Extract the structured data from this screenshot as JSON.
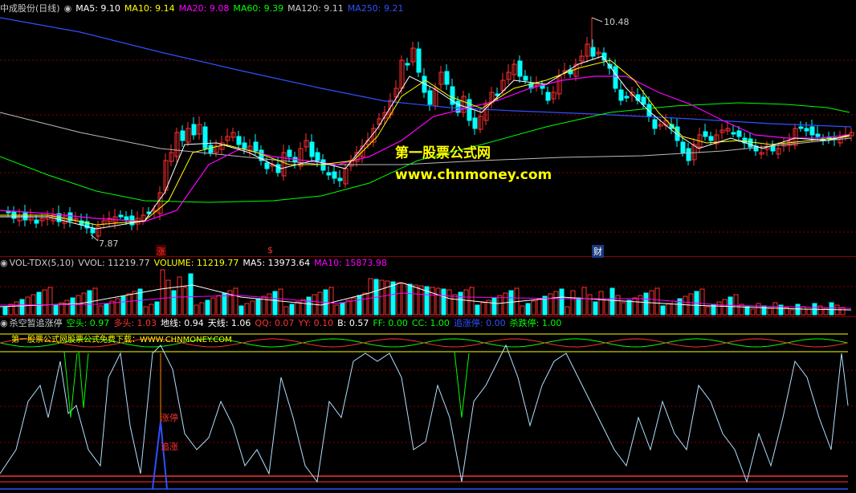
{
  "stock": {
    "name": "中成股份",
    "period": "(日线)"
  },
  "main_indicators": [
    {
      "label": "MA5: 9.10",
      "color": "#ffffff"
    },
    {
      "label": "MA10: 9.14",
      "color": "#ffff00"
    },
    {
      "label": "MA20: 9.08",
      "color": "#ff00ff"
    },
    {
      "label": "MA60: 9.39",
      "color": "#00ff00"
    },
    {
      "label": "MA120: 9.11",
      "color": "#cccccc"
    },
    {
      "label": "MA250: 9.21",
      "color": "#3050ff"
    }
  ],
  "price_marks": {
    "high": "10.48",
    "low": "7.87"
  },
  "event_tags": [
    {
      "text": "涨",
      "color": "#ff3030",
      "bg": "#4a0000"
    },
    {
      "text": "$",
      "color": "#ff3030",
      "bg": "#000000"
    },
    {
      "text": "财",
      "color": "#ffffff",
      "bg": "#1a3a80"
    }
  ],
  "watermark": {
    "line1": "第一股票公式网",
    "line2": "www.chnmoney.com"
  },
  "volume_indicators": [
    {
      "label": "VOL-TDX(5,10)",
      "color": "#cccccc"
    },
    {
      "label": "VVOL: 11219.77",
      "color": "#cccccc"
    },
    {
      "label": "VOLUME: 11219.77",
      "color": "#ffff00"
    },
    {
      "label": "MA5: 13973.64",
      "color": "#ffffff"
    },
    {
      "label": "MA10: 15873.98",
      "color": "#ff00ff"
    }
  ],
  "kill_indicators": [
    {
      "label": "杀空暂追涨停",
      "color": "#cccccc"
    },
    {
      "label": "空头: 0.97",
      "color": "#00ff00"
    },
    {
      "label": "多头: 1.03",
      "color": "#ff3030"
    },
    {
      "label": "地线: 0.94",
      "color": "#ffffff"
    },
    {
      "label": "天线: 1.06",
      "color": "#ffffff"
    },
    {
      "label": "QQ: 0.07",
      "color": "#ff3030"
    },
    {
      "label": "YY: 0.10",
      "color": "#ff3030"
    },
    {
      "label": "B: 0.57",
      "color": "#ffffff"
    },
    {
      "label": "FF: 0.00",
      "color": "#00ff00"
    },
    {
      "label": "CC: 1.00",
      "color": "#00ff00"
    },
    {
      "label": "追涨停: 0.00",
      "color": "#3050ff"
    },
    {
      "label": "杀跌停: 1.00",
      "color": "#00ff00"
    }
  ],
  "formula_banner": "第一股票公式网股票公式免费下载：WWW.CHNMONEY.COM",
  "signals": {
    "zhangting": "涨停",
    "zhuizhang": "追涨"
  },
  "colors": {
    "up": "#ff3030",
    "down": "#00ffff",
    "grid": "#8b0000"
  }
}
